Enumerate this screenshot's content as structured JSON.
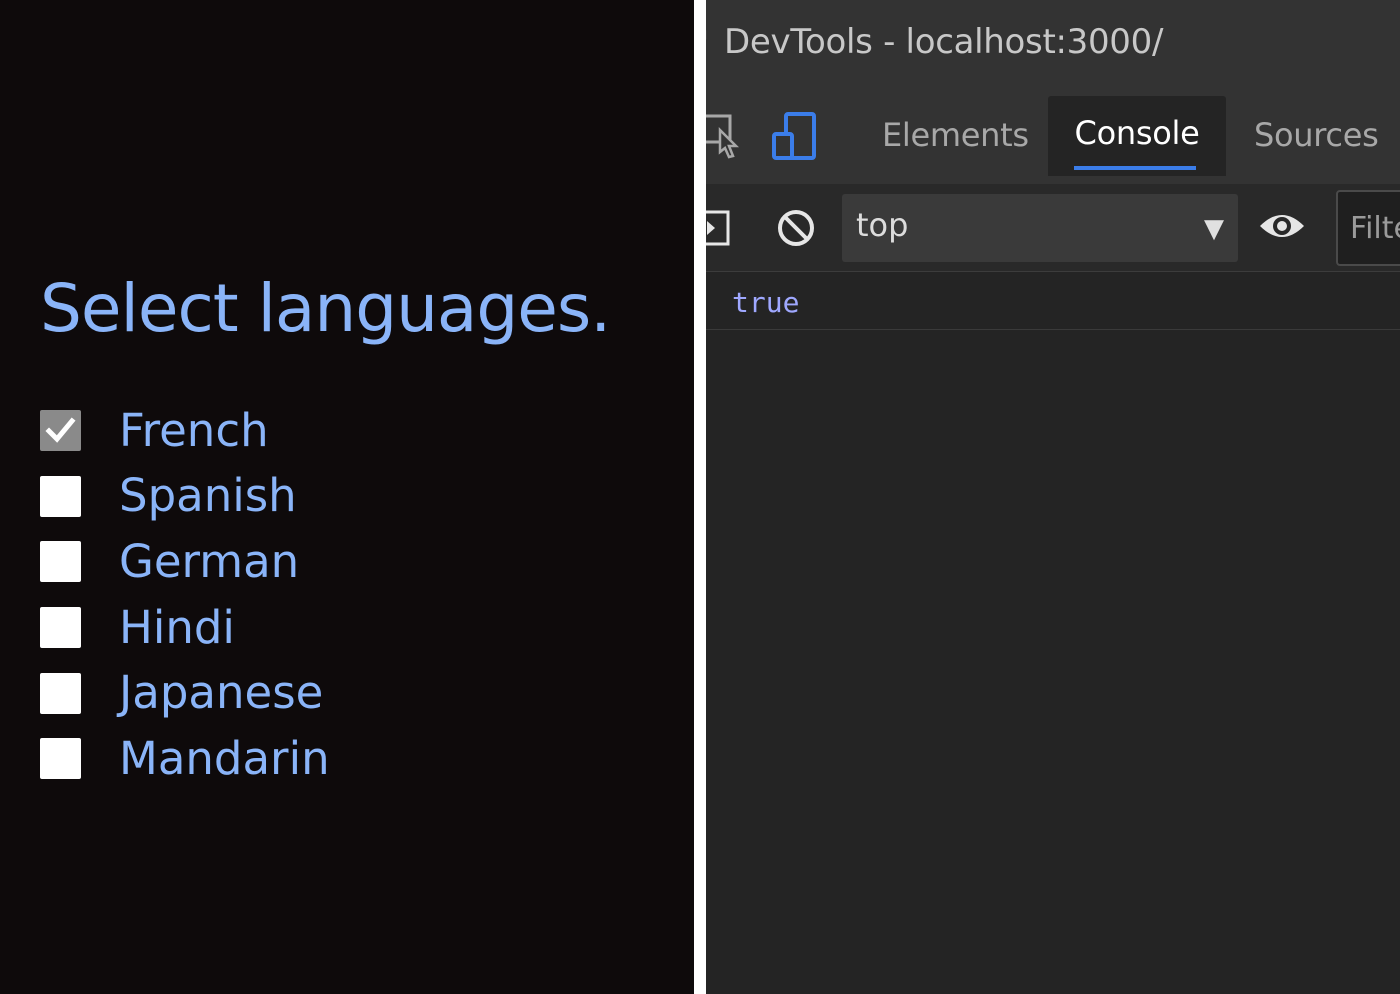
{
  "colors": {
    "page_background": "#0e0a0b",
    "accent_text": "#8ab4f8",
    "checkbox_checked": "#8a8a8a",
    "checkbox_unchecked": "#ffffff",
    "devtools_background": "#242424",
    "devtools_tab_active_underline": "#3b7de9",
    "console_boolean": "#9fa8ff"
  },
  "page": {
    "heading": "Select languages.",
    "languages": [
      {
        "label": "French",
        "checked": true
      },
      {
        "label": "Spanish",
        "checked": false
      },
      {
        "label": "German",
        "checked": false
      },
      {
        "label": "Hindi",
        "checked": false
      },
      {
        "label": "Japanese",
        "checked": false
      },
      {
        "label": "Mandarin",
        "checked": false
      }
    ]
  },
  "devtools": {
    "title": "DevTools - localhost:3000/",
    "tabs": [
      {
        "label": "Elements",
        "active": false
      },
      {
        "label": "Console",
        "active": true
      },
      {
        "label": "Sources",
        "active": false
      }
    ],
    "toolbar": {
      "icons": [
        "sidebar-toggle-icon",
        "clear-console-icon",
        "eye-icon"
      ],
      "context_value": "top",
      "filter_placeholder": "Filter"
    },
    "console": {
      "lines": [
        {
          "text": "true",
          "type": "boolean"
        }
      ]
    }
  }
}
